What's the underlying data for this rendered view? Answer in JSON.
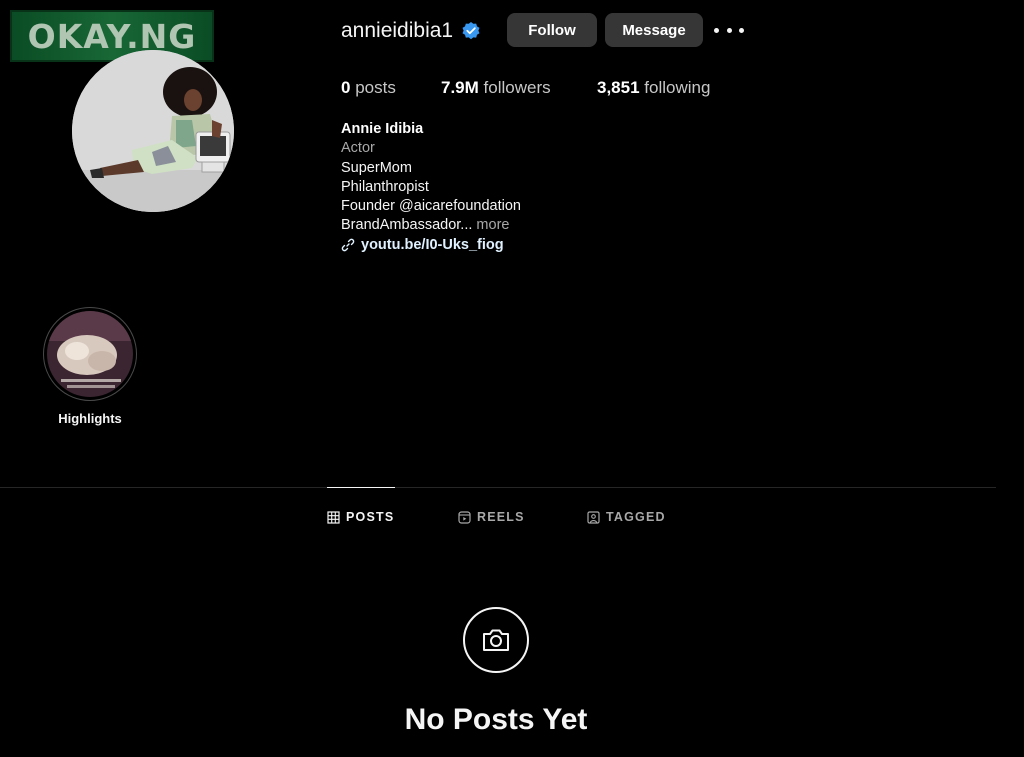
{
  "watermark": {
    "text": "OKAY.NG"
  },
  "profile": {
    "username": "annieidibia1",
    "follow_label": "Follow",
    "message_label": "Message"
  },
  "stats": {
    "posts_value": "0",
    "posts_label": "posts",
    "followers_value": "7.9M",
    "followers_label": "followers",
    "following_value": "3,851",
    "following_label": "following"
  },
  "bio": {
    "name": "Annie Idibia",
    "category": "Actor",
    "lines": [
      "SuperMom",
      "Philanthropist",
      "Founder @aicarefoundation",
      "BrandAmbassador..."
    ],
    "more": "more",
    "link": "youtu.be/I0-Uks_fiog"
  },
  "highlights": [
    {
      "label": "Highlights"
    }
  ],
  "tabs": [
    {
      "label": "POSTS",
      "icon": "grid-icon",
      "active": true
    },
    {
      "label": "REELS",
      "icon": "reels-icon",
      "active": false
    },
    {
      "label": "TAGGED",
      "icon": "tagged-icon",
      "active": false
    }
  ],
  "empty_state": {
    "title": "No Posts Yet",
    "icon": "camera-icon"
  },
  "colors": {
    "verified": "#3897f0",
    "button_bg": "#363636",
    "link": "#e0f1ff"
  }
}
